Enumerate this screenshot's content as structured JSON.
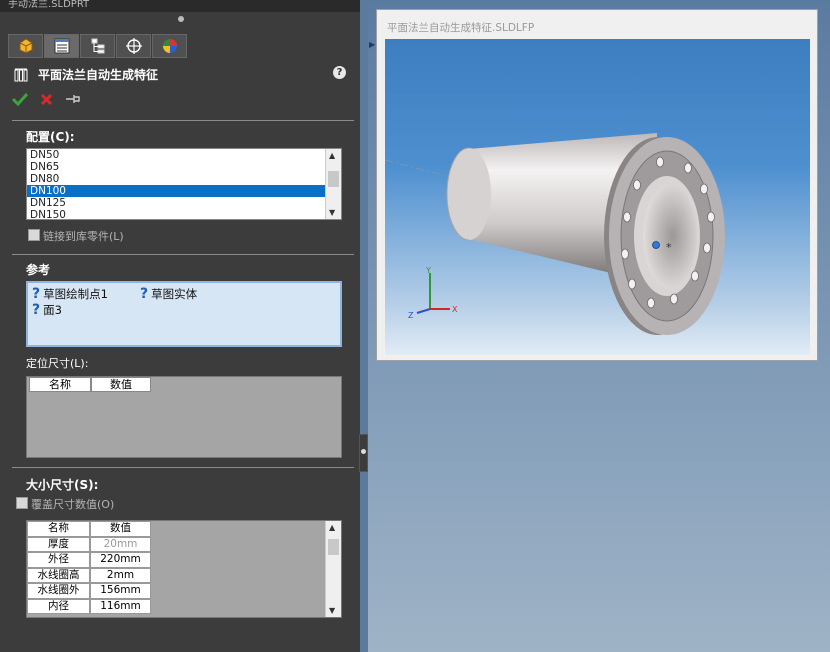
{
  "window": {
    "title": "手动法兰.SLDPRT"
  },
  "tabs": [
    {
      "name": "feature-manager-tab",
      "icon": "feature-manager-icon"
    },
    {
      "name": "property-manager-tab",
      "icon": "property-manager-icon"
    },
    {
      "name": "configuration-manager-tab",
      "icon": "configuration-manager-icon"
    },
    {
      "name": "dimxpert-manager-tab",
      "icon": "dimxpert-icon"
    },
    {
      "name": "display-manager-tab",
      "icon": "display-manager-icon"
    }
  ],
  "panel": {
    "title": "平面法兰自动生成特征",
    "help": "?"
  },
  "config": {
    "title": "配置(C):",
    "items": [
      "DN50",
      "DN65",
      "DN80",
      "DN100",
      "DN125",
      "DN150"
    ],
    "selected": "DN100",
    "link_label": "链接到库零件(L)"
  },
  "reference": {
    "title": "参考",
    "items": [
      "草图绘制点1",
      "草图实体",
      "面3"
    ]
  },
  "position": {
    "label": "定位尺寸(L):",
    "headers": [
      "名称",
      "数值"
    ]
  },
  "size": {
    "title": "大小尺寸(S):",
    "override_label": "覆盖尺寸数值(O)",
    "headers": [
      "名称",
      "数值"
    ],
    "rows": [
      {
        "name": "厚度",
        "value": "20mm",
        "dimmed": true
      },
      {
        "name": "外径",
        "value": "220mm"
      },
      {
        "name": "水线圈高",
        "value": "2mm"
      },
      {
        "name": "水线圈外",
        "value": "156mm"
      },
      {
        "name": "内径",
        "value": "116mm"
      }
    ]
  },
  "preview": {
    "title": "平面法兰自动生成特征.SLDLFP",
    "axes": {
      "x": "X",
      "y": "Y",
      "z": "Z"
    }
  },
  "colors": {
    "selection": "#0a6fc6",
    "panel": "#3c3c3c",
    "ok": "#3aa63a",
    "cancel": "#d92a2a"
  }
}
